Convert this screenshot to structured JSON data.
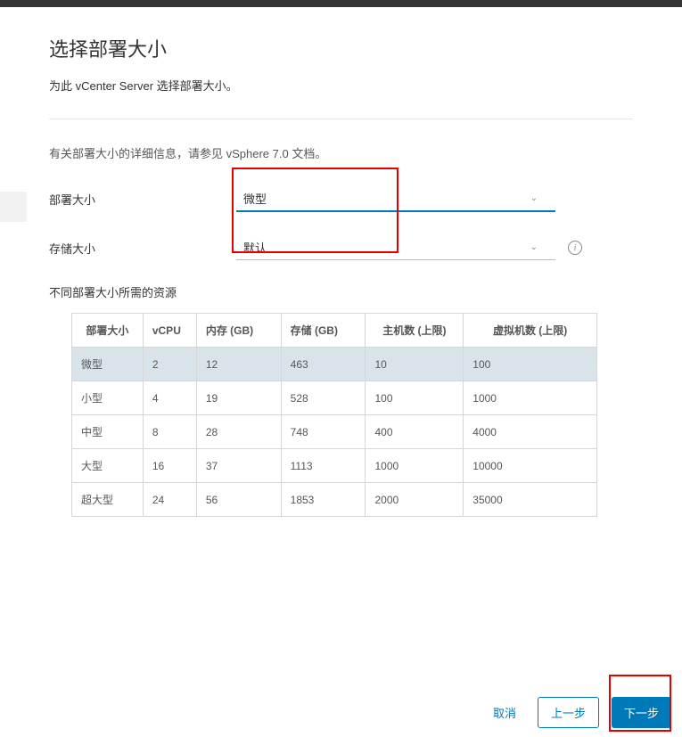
{
  "header": {
    "title": "选择部署大小",
    "subtitle": "为此 vCenter Server 选择部署大小。"
  },
  "info_text": "有关部署大小的详细信息，请参见 vSphere 7.0 文档。",
  "form": {
    "deploy_size": {
      "label": "部署大小",
      "value": "微型"
    },
    "storage_size": {
      "label": "存储大小",
      "value": "默认"
    }
  },
  "resources": {
    "section_title": "不同部署大小所需的资源",
    "columns": {
      "size": "部署大小",
      "vcpu": "vCPU",
      "memory": "内存 (GB)",
      "storage": "存储 (GB)",
      "hosts": "主机数 (上限)",
      "vms": "虚拟机数 (上限)"
    },
    "rows": [
      {
        "size": "微型",
        "vcpu": "2",
        "memory": "12",
        "storage": "463",
        "hosts": "10",
        "vms": "100",
        "selected": true
      },
      {
        "size": "小型",
        "vcpu": "4",
        "memory": "19",
        "storage": "528",
        "hosts": "100",
        "vms": "1000",
        "selected": false
      },
      {
        "size": "中型",
        "vcpu": "8",
        "memory": "28",
        "storage": "748",
        "hosts": "400",
        "vms": "4000",
        "selected": false
      },
      {
        "size": "大型",
        "vcpu": "16",
        "memory": "37",
        "storage": "1113",
        "hosts": "1000",
        "vms": "10000",
        "selected": false
      },
      {
        "size": "超大型",
        "vcpu": "24",
        "memory": "56",
        "storage": "1853",
        "hosts": "2000",
        "vms": "35000",
        "selected": false
      }
    ]
  },
  "footer": {
    "cancel": "取消",
    "back": "上一步",
    "next": "下一步"
  }
}
